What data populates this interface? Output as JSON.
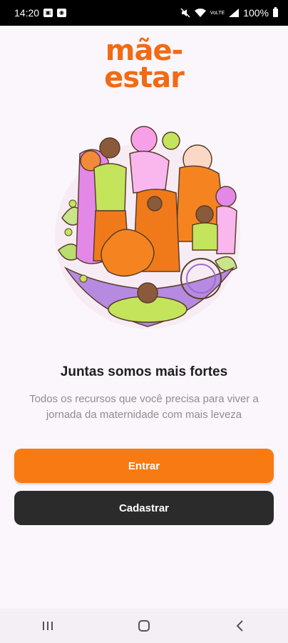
{
  "status_bar": {
    "time": "14:20",
    "battery": "100%",
    "left_icons": [
      "photo-notification-icon",
      "app-notification-icon"
    ],
    "right_icons": [
      "mute-icon",
      "wifi-icon",
      "volte-icon",
      "signal-icon",
      "battery-icon"
    ],
    "volte_label": "VoLTE"
  },
  "app": {
    "logo_line1": "mãe-",
    "logo_line2": "estar",
    "brand_color": "#f26a13"
  },
  "main": {
    "headline": "Juntas somos mais fortes",
    "subtitle": "Todos os recursos que você precisa para viver a jornada da maternidade com mais leveza"
  },
  "actions": {
    "primary_label": "Entrar",
    "secondary_label": "Cadastrar",
    "primary_color": "#f87a13",
    "secondary_color": "#2b2b2b"
  },
  "nav": {
    "icons": [
      "recent-apps-icon",
      "home-icon",
      "back-icon"
    ]
  }
}
